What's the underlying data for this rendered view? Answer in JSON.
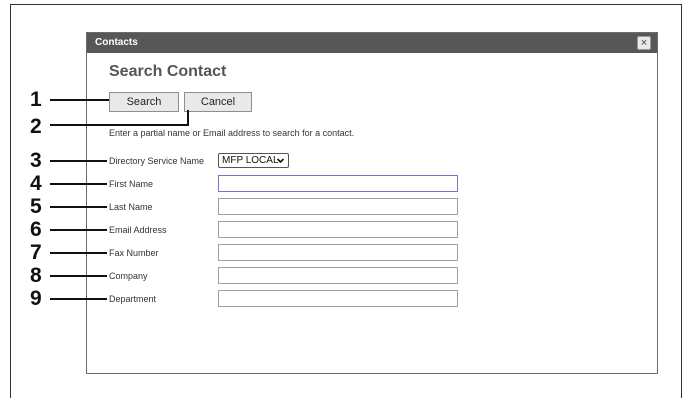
{
  "dialog": {
    "title": "Contacts",
    "close_glyph": "×",
    "heading": "Search Contact",
    "buttons": {
      "search": "Search",
      "cancel": "Cancel"
    },
    "hint": "Enter a partial name or Email address to search for a contact.",
    "fields": {
      "directory_label": "Directory Service Name",
      "directory_value": "MFP LOCAL",
      "first_name": "First Name",
      "last_name": "Last Name",
      "email": "Email Address",
      "fax": "Fax Number",
      "company": "Company",
      "department": "Department"
    }
  },
  "callouts": [
    "1",
    "2",
    "3",
    "4",
    "5",
    "6",
    "7",
    "8",
    "9"
  ]
}
